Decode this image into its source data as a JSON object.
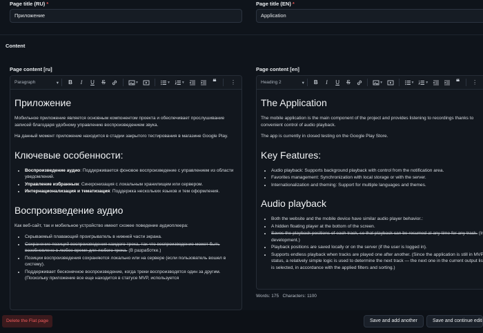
{
  "page_title_ru": {
    "label": "Page title (RU)",
    "required": "*",
    "value": "Приложение"
  },
  "page_title_en": {
    "label": "Page title (EN)",
    "required": "*",
    "value": "Application"
  },
  "content_section": "Content",
  "editor_ru": {
    "label": "Page content [ru]",
    "block_format": "Paragraph",
    "h1": "Приложение",
    "p1": "Мобильное приложение является основным компонентом проекта и обеспечивает прослушивание записей благодаря удобному управлению воспроизведением звука.",
    "p2": "На данный момент приложение находится в стадии закрытого тестирования в магазине Google Play.",
    "h2": "Ключевые особенности:",
    "features": [
      {
        "bold": "Воспроизведение аудио",
        "text": ": Поддерживается фоновое воспроизведение с управлением из области уведомлений."
      },
      {
        "bold": "Управление избранным",
        "text": ": Синхронизация с локальным хранилищем или сервером."
      },
      {
        "bold": "Интернационализация и тематизация",
        "text": ": Поддержка нескольких языков и тем оформления."
      }
    ],
    "h3": "Воспроизведение аудио",
    "p3": "Как веб-сайт, так и мобильное устройство имеют схожее поведение аудиоплеера:",
    "audio_items": [
      {
        "text": "Скрываемый плавающий проигрыватель в нижней части экрана."
      },
      {
        "strike": "Сохранение позиций воспроизведения каждого трека, так что воспроизведение может быть возобновлено в любое время для любого трека.",
        "text": " (В разработке.)"
      },
      {
        "text": "Позиции воспроизведения сохраняются локально или на сервере (если пользователь вошел в систему)."
      },
      {
        "text": "Поддерживает бесконечное воспроизведение, когда треки воспроизводятся один за другим. (Поскольку приложение все еще находится в статусе MVP, используется"
      }
    ]
  },
  "editor_en": {
    "label": "Page content [en]",
    "block_format": "Heading 2",
    "h1": "The Application",
    "p1": "The mobile application is the main component of the project and provides listening to recordings thanks to convenient control of audio playback.",
    "p2": "The app is currently in closed testing on the Google Play Store.",
    "h2": "Key Features:",
    "features": [
      "Audio playback: Supports background playback with control from the notification area.",
      "Favorites management: Synchronization with local storage or with the server.",
      "Internationalization and theming: Support for multiple languages and themes."
    ],
    "h3": "Audio playback",
    "audio_items": [
      {
        "text": "Both the website and the mobile device have similar audio player behavior.:"
      },
      {
        "text": "A hidden floating player at the bottom of the screen."
      },
      {
        "strike": "Saves the playback positions of each track, so that playback can be resumed at any time for any track.",
        "text": " (In development.)"
      },
      {
        "text": "Playback positions are saved locally or on the server (if the user is logged in)."
      },
      {
        "text": "Supports endless playback when tracks are played one after another. (Since the application is still in MVP status, a relatively simple logic is used to determine the next track — the next one in the current output list is selected, in accordance with the applied filters and sorting.)"
      }
    ],
    "words": "Words: 175",
    "characters": "Characters: 1100"
  },
  "actions": {
    "delete": "Delete the Flat page",
    "save_add": "Save and add another",
    "save_continue": "Save and continue editing"
  },
  "colors": {
    "background": "#0f141b",
    "danger": "#f05b5b",
    "danger_bg": "#3a1a1d"
  },
  "toolbar_icons": [
    "bold-icon",
    "italic-icon",
    "underline-icon",
    "strikethrough-icon",
    "link-icon",
    "image-icon",
    "media-icon",
    "bullet-list-icon",
    "numbered-list-icon",
    "outdent-icon",
    "indent-icon",
    "blockquote-icon",
    "more-icon"
  ]
}
